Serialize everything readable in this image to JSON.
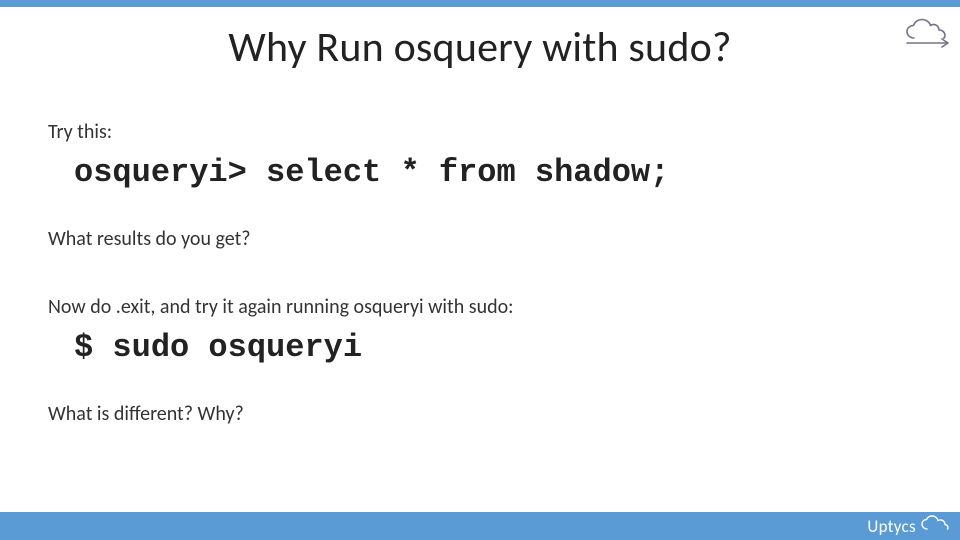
{
  "title": "Why Run osquery with sudo?",
  "body": {
    "p1": "Try this:",
    "code1": "osqueryi> select * from shadow;",
    "p2": "What results do you get?",
    "p3": "Now do .exit, and try it again running osqueryi with sudo:",
    "code2": "$ sudo osqueryi",
    "p4": "What is different? Why?"
  },
  "brand": "Uptycs",
  "icons": {
    "cloud_top": "cloud-arrow-icon",
    "cloud_bottom": "cloud-icon"
  },
  "colors": {
    "accent": "#5b9bd5",
    "topbar": "#5b9bd5",
    "text": "#222222"
  }
}
